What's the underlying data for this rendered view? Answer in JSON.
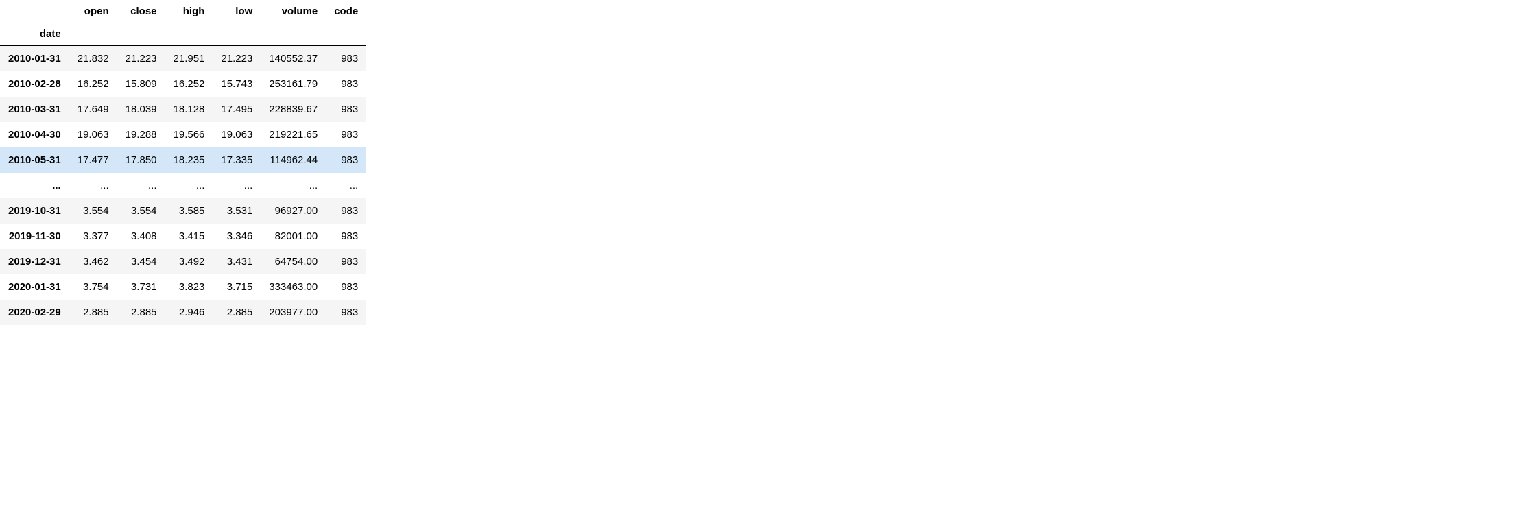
{
  "table": {
    "index_name": "date",
    "columns": [
      "open",
      "close",
      "high",
      "low",
      "volume",
      "code"
    ],
    "rows": [
      {
        "index": "2010-01-31",
        "cells": [
          "21.832",
          "21.223",
          "21.951",
          "21.223",
          "140552.37",
          "983"
        ],
        "highlighted": false
      },
      {
        "index": "2010-02-28",
        "cells": [
          "16.252",
          "15.809",
          "16.252",
          "15.743",
          "253161.79",
          "983"
        ],
        "highlighted": false
      },
      {
        "index": "2010-03-31",
        "cells": [
          "17.649",
          "18.039",
          "18.128",
          "17.495",
          "228839.67",
          "983"
        ],
        "highlighted": false
      },
      {
        "index": "2010-04-30",
        "cells": [
          "19.063",
          "19.288",
          "19.566",
          "19.063",
          "219221.65",
          "983"
        ],
        "highlighted": false
      },
      {
        "index": "2010-05-31",
        "cells": [
          "17.477",
          "17.850",
          "18.235",
          "17.335",
          "114962.44",
          "983"
        ],
        "highlighted": true
      },
      {
        "index": "...",
        "cells": [
          "...",
          "...",
          "...",
          "...",
          "...",
          "..."
        ],
        "highlighted": false
      },
      {
        "index": "2019-10-31",
        "cells": [
          "3.554",
          "3.554",
          "3.585",
          "3.531",
          "96927.00",
          "983"
        ],
        "highlighted": false
      },
      {
        "index": "2019-11-30",
        "cells": [
          "3.377",
          "3.408",
          "3.415",
          "3.346",
          "82001.00",
          "983"
        ],
        "highlighted": false
      },
      {
        "index": "2019-12-31",
        "cells": [
          "3.462",
          "3.454",
          "3.492",
          "3.431",
          "64754.00",
          "983"
        ],
        "highlighted": false
      },
      {
        "index": "2020-01-31",
        "cells": [
          "3.754",
          "3.731",
          "3.823",
          "3.715",
          "333463.00",
          "983"
        ],
        "highlighted": false
      },
      {
        "index": "2020-02-29",
        "cells": [
          "2.885",
          "2.885",
          "2.946",
          "2.885",
          "203977.00",
          "983"
        ],
        "highlighted": false
      }
    ]
  }
}
